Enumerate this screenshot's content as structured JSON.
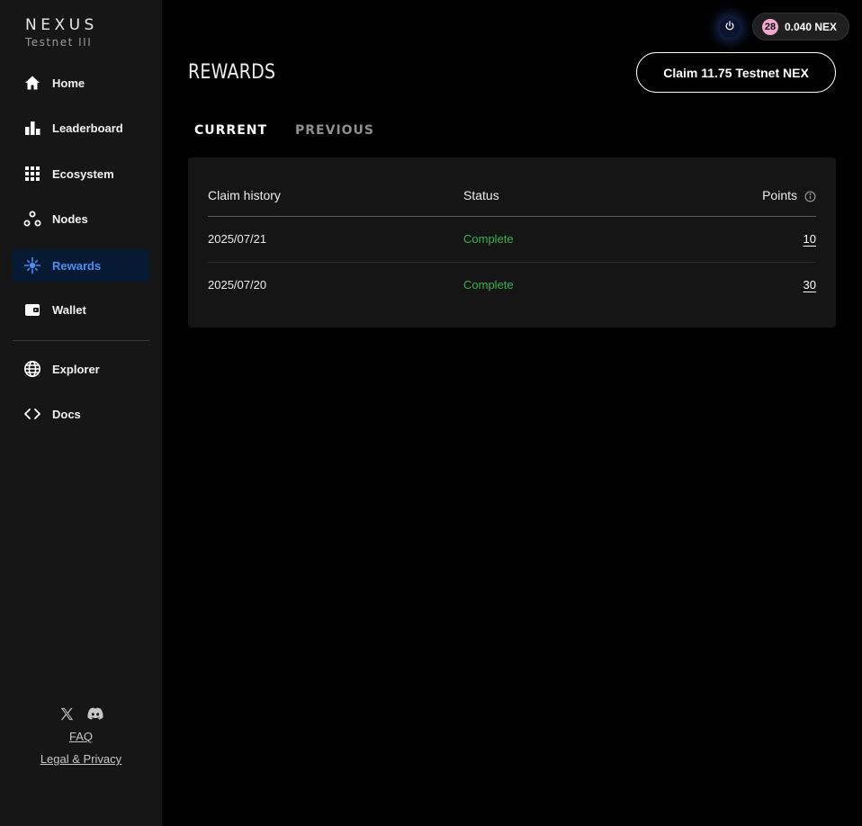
{
  "brand": {
    "name": "NEXUS",
    "subtitle": "Testnet III"
  },
  "sidebar": {
    "items": [
      {
        "label": "Home",
        "icon": "home-icon"
      },
      {
        "label": "Leaderboard",
        "icon": "leaderboard-icon"
      },
      {
        "label": "Ecosystem",
        "icon": "grid-icon"
      },
      {
        "label": "Nodes",
        "icon": "nodes-icon"
      },
      {
        "label": "Rewards",
        "icon": "rewards-icon",
        "active": true
      },
      {
        "label": "Wallet",
        "icon": "wallet-icon"
      },
      {
        "label": "Explorer",
        "icon": "globe-icon"
      },
      {
        "label": "Docs",
        "icon": "code-icon"
      }
    ],
    "social": [
      "x-icon",
      "discord-icon"
    ],
    "faq": "FAQ",
    "legal": "Legal & Privacy"
  },
  "topbar": {
    "badge": "28",
    "balance": "0.040 NEX"
  },
  "main": {
    "title": "REWARDS",
    "claim_button": "Claim 11.75 Testnet NEX",
    "tabs": [
      {
        "label": "CURRENT",
        "active": true
      },
      {
        "label": "PREVIOUS",
        "active": false
      }
    ],
    "table": {
      "headers": {
        "history": "Claim history",
        "status": "Status",
        "points": "Points"
      },
      "rows": [
        {
          "date": "2025/07/21",
          "status": "Complete",
          "points": "10"
        },
        {
          "date": "2025/07/20",
          "status": "Complete",
          "points": "30"
        }
      ]
    }
  },
  "colors": {
    "accent": "#4a8ff5",
    "active_bg": "#071a33",
    "status_complete": "#36b24a",
    "badge_pink": "#f3a6d0"
  }
}
